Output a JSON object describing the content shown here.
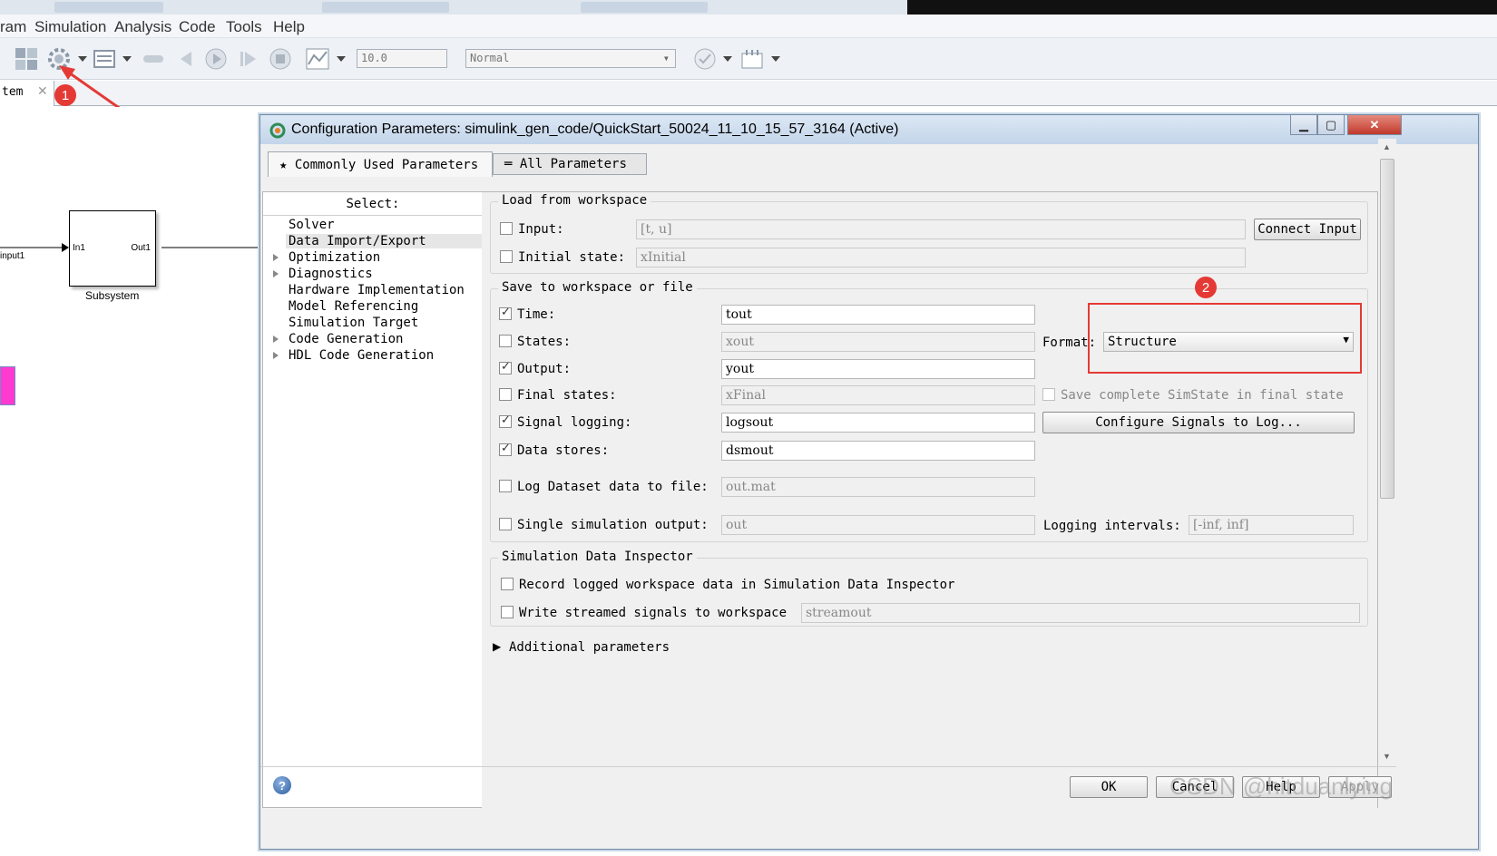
{
  "menu": {
    "items": [
      "ram",
      "Simulation",
      "Analysis",
      "Code",
      "Tools",
      "Help"
    ]
  },
  "toolbar": {
    "stop_time": "10.0",
    "sim_mode": "Normal",
    "icons": [
      "library-browser-icon",
      "model-config-icon",
      "model-explorer-icon",
      "step-back-icon",
      "run-icon",
      "step-forward-icon",
      "stop-icon",
      "scope-icon",
      "check-icon",
      "build-icon"
    ]
  },
  "model_tab": {
    "label": "tem"
  },
  "canvas": {
    "input_label": "input1",
    "block_name": "Subsystem",
    "port_in": "In1",
    "port_out": "Out1"
  },
  "annotations": {
    "one": "1",
    "two": "2"
  },
  "dialog": {
    "title": "Configuration Parameters: simulink_gen_code/QuickStart_50024_11_10_15_57_3164 (Active)",
    "tabs": {
      "common": "Commonly Used Parameters",
      "all": "All Parameters"
    },
    "tree": {
      "header": "Select:",
      "items": [
        "Solver",
        "Data Import/Export",
        "Optimization",
        "Diagnostics",
        "Hardware Implementation",
        "Model Referencing",
        "Simulation Target",
        "Code Generation",
        "HDL Code Generation"
      ]
    },
    "load": {
      "legend": "Load from workspace",
      "input_label": "Input:",
      "input_value": "[t, u]",
      "connect_button": "Connect Input",
      "initial_label": "Initial state:",
      "initial_value": "xInitial"
    },
    "save": {
      "legend": "Save to workspace or file",
      "time_label": "Time:",
      "time_value": "tout",
      "states_label": "States:",
      "states_value": "xout",
      "format_label": "Format:",
      "format_value": "Structure",
      "output_label": "Output:",
      "output_value": "yout",
      "final_label": "Final states:",
      "final_value": "xFinal",
      "simstate_label": "Save complete SimState in final state",
      "signal_label": "Signal logging:",
      "signal_value": "logsout",
      "configure_button": "Configure Signals to Log...",
      "datastores_label": "Data stores:",
      "datastores_value": "dsmout",
      "logfile_label": "Log Dataset data to file:",
      "logfile_value": "out.mat",
      "single_label": "Single simulation output:",
      "single_value": "out",
      "intervals_label": "Logging intervals:",
      "intervals_value": "[-inf, inf]"
    },
    "sdi": {
      "legend": "Simulation Data Inspector",
      "record_label": "Record logged workspace data in Simulation Data Inspector",
      "write_label": "Write streamed signals to workspace",
      "write_value": "streamout"
    },
    "additional": "Additional parameters",
    "buttons": {
      "ok": "OK",
      "cancel": "Cancel",
      "help": "Help",
      "apply": "Apply"
    },
    "watermark": "CSDN @hitduanlying"
  }
}
